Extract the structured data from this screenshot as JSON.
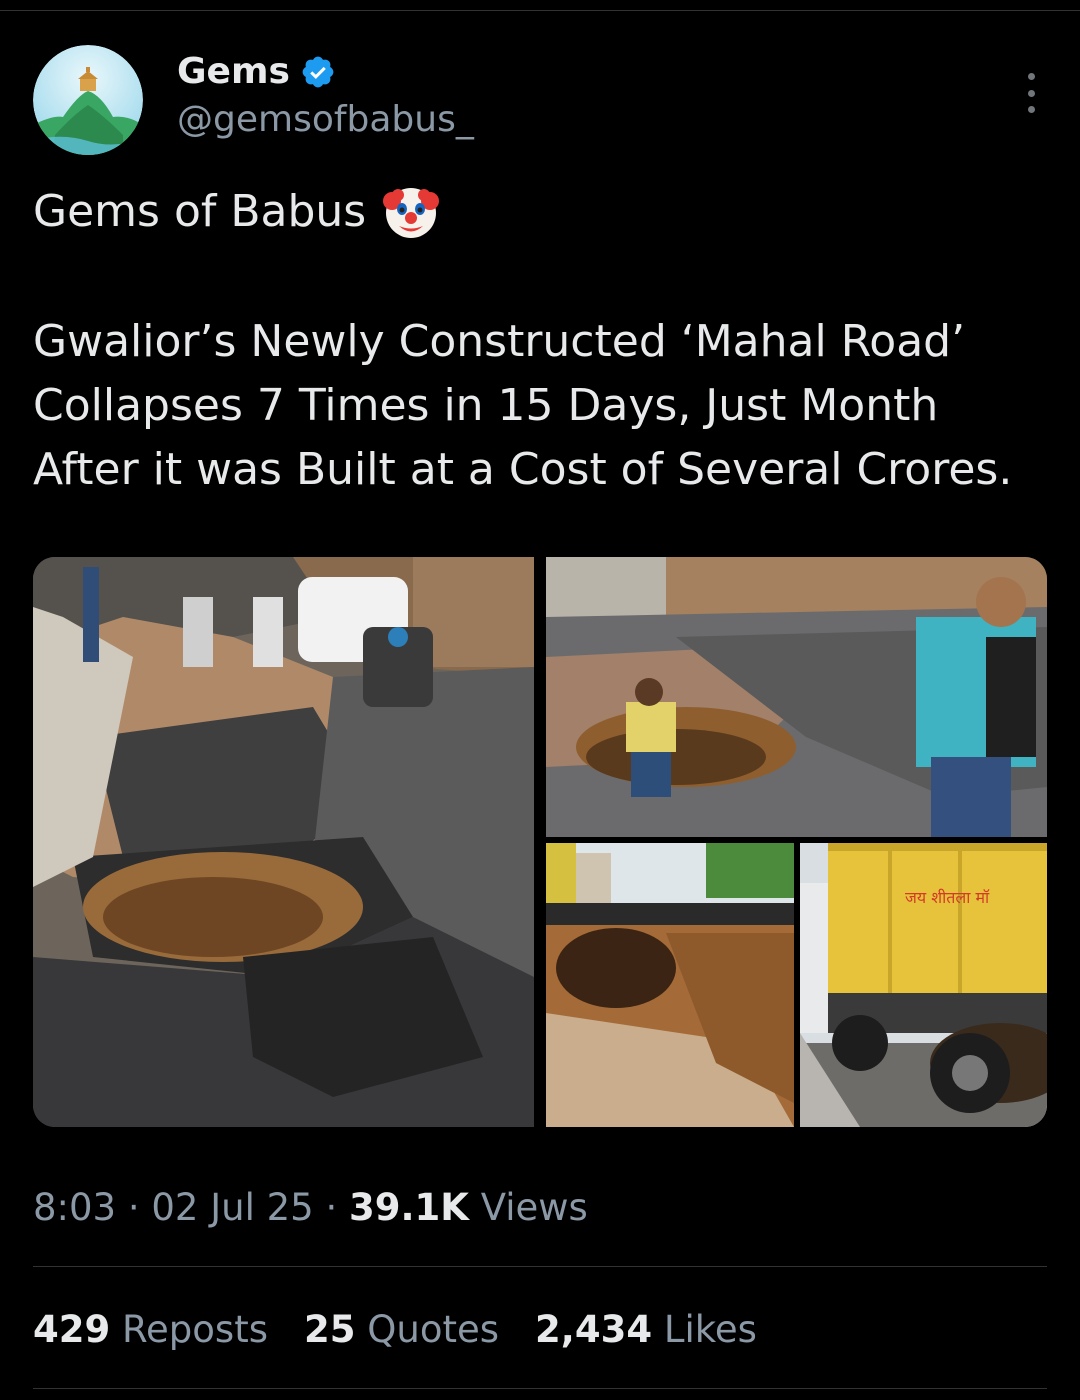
{
  "author": {
    "display_name": "Gems",
    "handle": "@gemsofbabus_",
    "verified": true,
    "avatar_icon": "hilltop-temple-avatar"
  },
  "tweet": {
    "first_line": "Gems of Babus",
    "emoji": "clown-face-icon",
    "body": "Gwalior’s Newly Constructed ‘Mahal Road’ Collapses 7 Times in 15 Days, Just Month After it was Built at a Cost of Several Crores."
  },
  "media": {
    "count": 4,
    "truck_sign": "जय शीतला मॉ"
  },
  "meta": {
    "time": "8:03",
    "separator": "·",
    "date": "02 Jul 25",
    "views_count": "39.1K",
    "views_label": "Views"
  },
  "stats": {
    "reposts_count": "429",
    "reposts_label": "Reposts",
    "quotes_count": "25",
    "quotes_label": "Quotes",
    "likes_count": "2,434",
    "likes_label": "Likes"
  },
  "colors": {
    "background": "#000000",
    "text_primary": "#e7e9ea",
    "text_secondary": "#8b98a5",
    "verified_blue": "#1d9bf0",
    "divider": "#2f3336"
  }
}
